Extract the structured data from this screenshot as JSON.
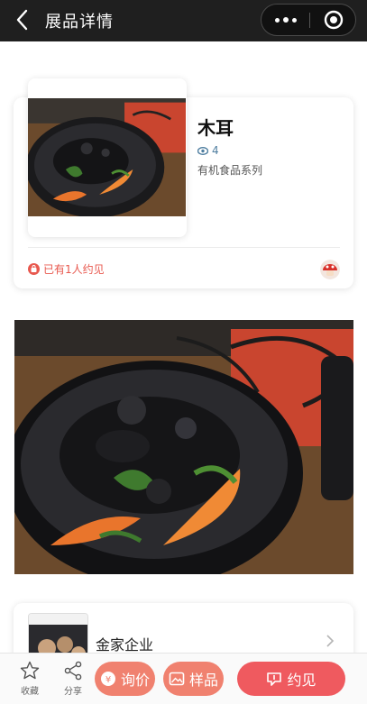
{
  "header": {
    "title": "展品详情",
    "back_icon": "chevron-left-icon",
    "more_icon": "more-dots-icon",
    "close_icon": "target-close-icon"
  },
  "product": {
    "name": "木耳",
    "views": "4",
    "series": "有机食品系列",
    "meet_text": "已有1人约见"
  },
  "company": {
    "name": "金家企业"
  },
  "bottom_bar": {
    "favorite_label": "收藏",
    "share_label": "分享",
    "inquire_label": "询价",
    "sample_label": "样品",
    "meet_label": "约见"
  },
  "colors": {
    "topbar": "#1f1f1f",
    "accent": "#ef5a5f",
    "accent_light": "#f0816f",
    "link_blue": "#4f7ea0"
  }
}
